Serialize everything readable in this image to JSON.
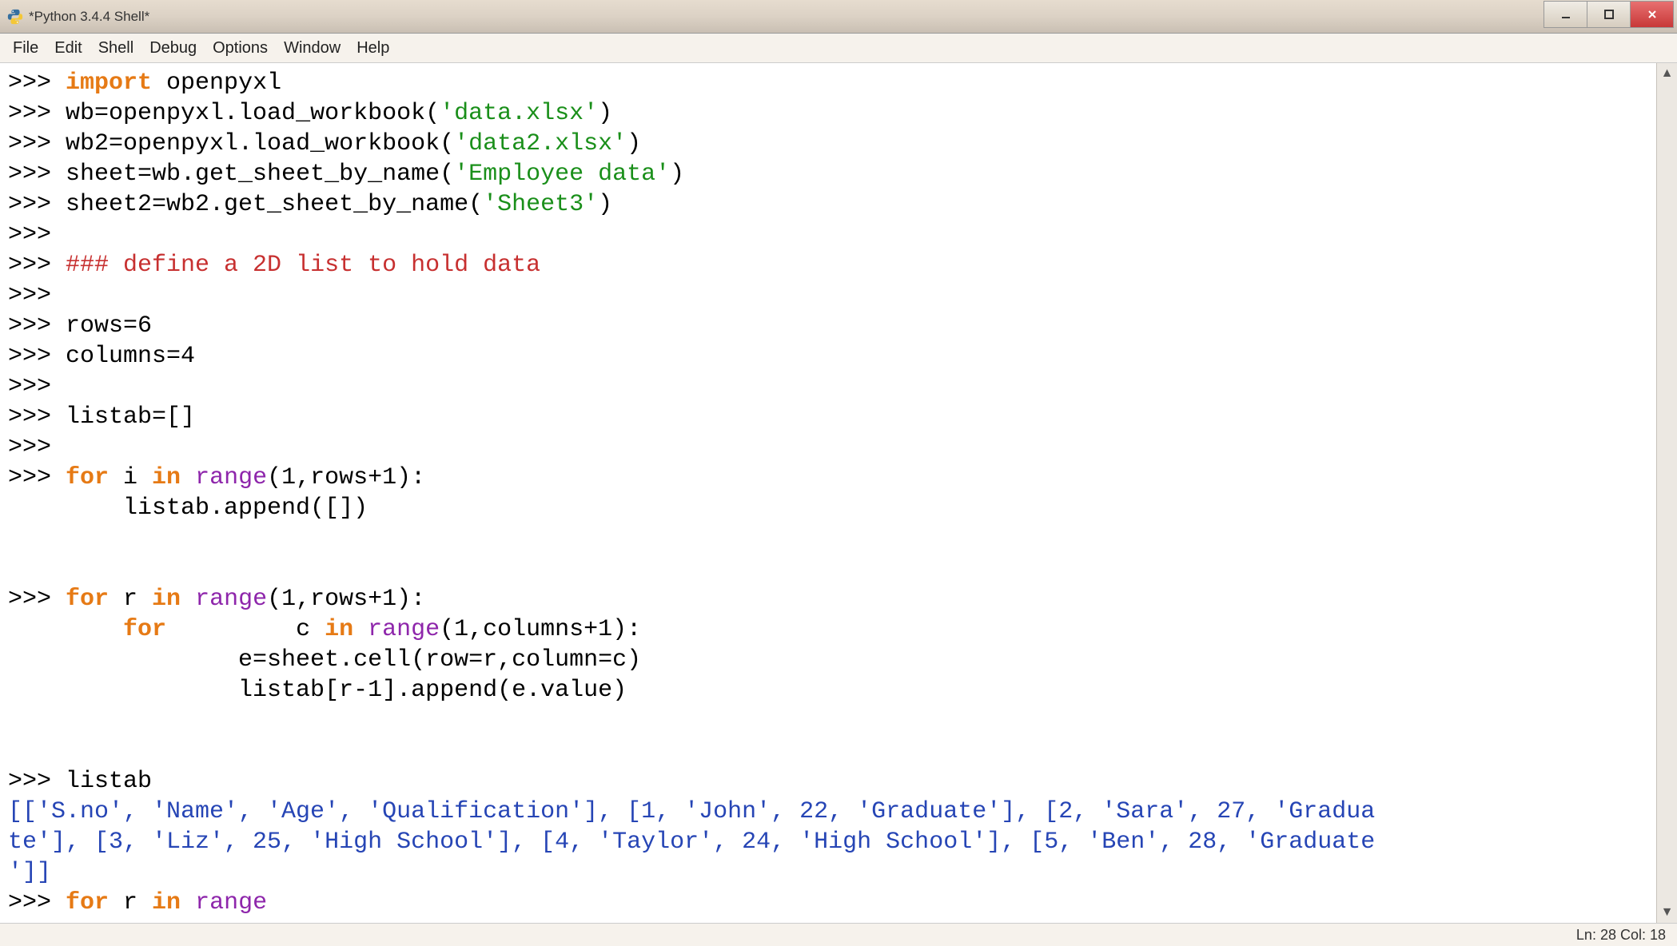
{
  "window": {
    "title": "*Python 3.4.4 Shell*"
  },
  "menubar": {
    "items": [
      "File",
      "Edit",
      "Shell",
      "Debug",
      "Options",
      "Window",
      "Help"
    ]
  },
  "code": {
    "prompt": ">>> ",
    "kw_import": "import",
    "openpyxl": " openpyxl",
    "l2_a": "wb=openpyxl.load_workbook(",
    "l2_s": "'data.xlsx'",
    "l2_c": ")",
    "l3_a": "wb2=openpyxl.load_workbook(",
    "l3_s": "'data2.xlsx'",
    "l3_c": ")",
    "l4_a": "sheet=wb.get_sheet_by_name(",
    "l4_s": "'Employee data'",
    "l4_c": ")",
    "l5_a": "sheet2=wb2.get_sheet_by_name(",
    "l5_s": "'Sheet3'",
    "l5_c": ")",
    "comment": "### define a 2D list to hold data",
    "rows": "rows=6",
    "columns": "columns=4",
    "listab_init": "listab=[]",
    "kw_for": "for",
    "kw_in": "in",
    "kw_range": "range",
    "loop1_a": " i ",
    "loop1_b": "(1,rows+1):",
    "loop1_body": "        listab.append([])",
    "loop2_a": " r ",
    "loop2_b": "(1,rows+1):",
    "loop2_inner_a": "         c ",
    "loop2_inner_b": "(1,columns+1):",
    "loop2_body1": "                e=sheet.cell(row=r,column=c)",
    "loop2_body2": "                listab[r-1].append(e.value)",
    "listab_call": "listab",
    "output_line1": "[['S.no', 'Name', 'Age', 'Qualification'], [1, 'John', 22, 'Graduate'], [2, 'Sara', 27, 'Gradua",
    "output_line2": "te'], [3, 'Liz', 25, 'High School'], [4, 'Taylor', 24, 'High School'], [5, 'Ben', 28, 'Graduate",
    "output_line3": "']]",
    "last_a": " r ",
    "last_b": ""
  },
  "statusbar": {
    "pos": "Ln: 28  Col: 18"
  }
}
